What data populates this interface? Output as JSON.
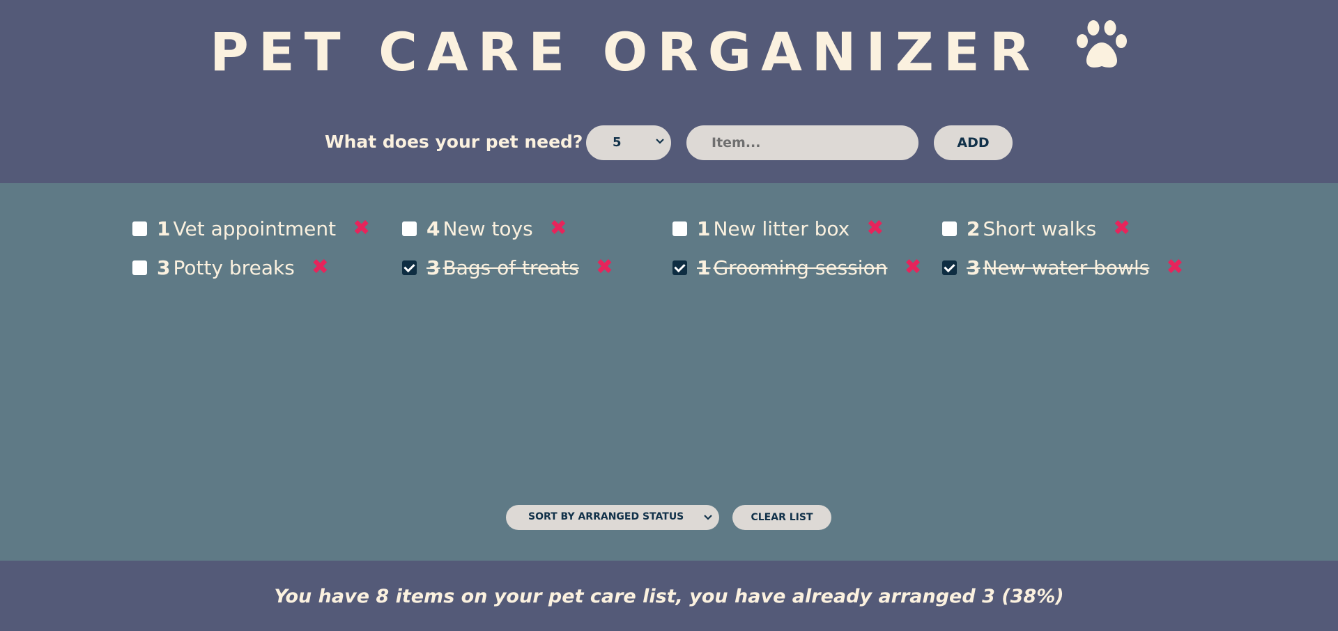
{
  "header": {
    "title": "PET CARE ORGANIZER",
    "icon": "paw-icon"
  },
  "form": {
    "label": "What does your pet need?",
    "quantity_selected": "5",
    "item_placeholder": "Item...",
    "add_label": "ADD"
  },
  "items": [
    {
      "qty": "1",
      "text": "Vet appointment",
      "packed": false
    },
    {
      "qty": "4",
      "text": "New toys",
      "packed": false
    },
    {
      "qty": "1",
      "text": "New litter box",
      "packed": false
    },
    {
      "qty": "2",
      "text": "Short walks",
      "packed": false
    },
    {
      "qty": "3",
      "text": "Potty breaks",
      "packed": false
    },
    {
      "qty": "3",
      "text": "Bags of treats",
      "packed": true
    },
    {
      "qty": "1",
      "text": "Grooming session",
      "packed": true
    },
    {
      "qty": "3",
      "text": "New water bowls",
      "packed": true
    }
  ],
  "actions": {
    "sort_selected": "SORT BY ARRANGED STATUS",
    "clear_label": "CLEAR LIST"
  },
  "footer": {
    "stats": "You have 8 items on your pet care list, you have already arranged 3 (38%)"
  },
  "colors": {
    "header_bg": "#545a78",
    "main_bg": "#5f7a86",
    "text": "#fbf1df",
    "accent_delete": "#e7245b",
    "control_bg": "#ddd9d5",
    "control_text": "#113149"
  }
}
